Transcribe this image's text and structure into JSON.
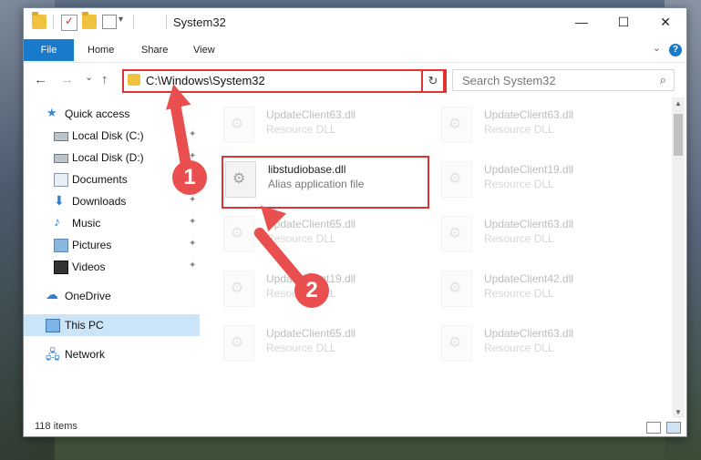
{
  "window": {
    "title": "System32",
    "controls": {
      "minimize": "—",
      "maximize": "☐",
      "close": "✕"
    }
  },
  "ribbon": {
    "tabs": [
      "File",
      "Home",
      "Share",
      "View"
    ],
    "help": "?"
  },
  "navigation": {
    "back": "←",
    "forward": "→",
    "recent": "⌄",
    "up": "↑",
    "address": "C:\\Windows\\System32",
    "refresh": "↻",
    "search_placeholder": "Search System32"
  },
  "sidebar": {
    "items": [
      {
        "label": "Quick access",
        "icon": "star-icon",
        "pinned": false
      },
      {
        "label": "Local Disk (C:)",
        "icon": "drive-icon",
        "pinned": true
      },
      {
        "label": "Local Disk (D:)",
        "icon": "drive-icon",
        "pinned": true
      },
      {
        "label": "Documents",
        "icon": "documents-icon",
        "pinned": true
      },
      {
        "label": "Downloads",
        "icon": "download-icon",
        "pinned": true
      },
      {
        "label": "Music",
        "icon": "music-icon",
        "pinned": true
      },
      {
        "label": "Pictures",
        "icon": "pictures-icon",
        "pinned": true
      },
      {
        "label": "Videos",
        "icon": "videos-icon",
        "pinned": true
      },
      {
        "label": "OneDrive",
        "icon": "cloud-icon",
        "pinned": false
      },
      {
        "label": "This PC",
        "icon": "pc-icon",
        "pinned": false,
        "selected": true
      },
      {
        "label": "Network",
        "icon": "network-icon",
        "pinned": false
      }
    ]
  },
  "files": {
    "left": [
      {
        "name": "UpdateClient63.dll",
        "type": "Resource DLL"
      },
      {
        "name": "libstudiobase.dll",
        "type": "Alias application file",
        "highlighted": true
      },
      {
        "name": "UpdateClient65.dll",
        "type": "Resource DLL"
      },
      {
        "name": "UpdateClient19.dll",
        "type": "Resource DLL"
      },
      {
        "name": "UpdateClient65.dll",
        "type": "Resource DLL"
      }
    ],
    "right": [
      {
        "name": "UpdateClient63.dll",
        "type": "Resource DLL"
      },
      {
        "name": "UpdateClient19.dll",
        "type": "Resource DLL"
      },
      {
        "name": "UpdateClient63.dll",
        "type": "Resource DLL"
      },
      {
        "name": "UpdateClient42.dll",
        "type": "Resource DLL"
      },
      {
        "name": "UpdateClient63.dll",
        "type": "Resource DLL"
      }
    ]
  },
  "status": {
    "item_count": "118 items"
  },
  "annotations": {
    "step1": "1",
    "step2": "2",
    "color": "#ea4f4f"
  }
}
